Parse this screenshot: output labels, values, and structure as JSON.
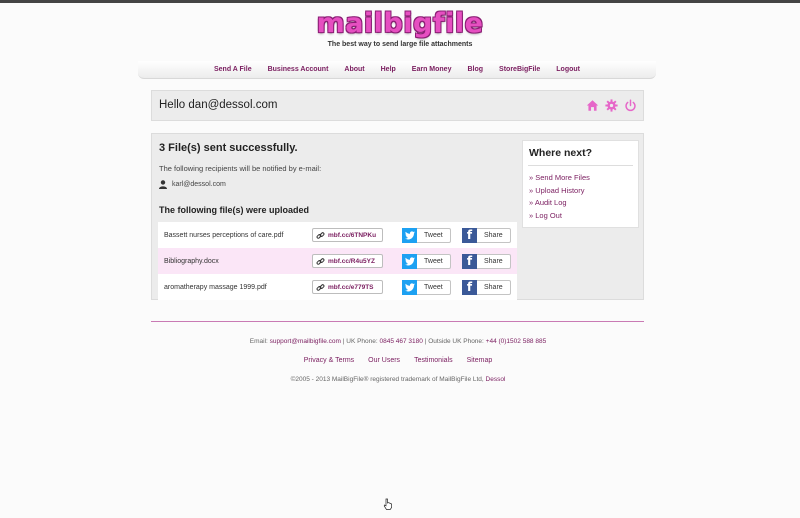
{
  "brand": {
    "logo": "mailbigfile",
    "tagline": "The best way to send large file attachments"
  },
  "nav": [
    "Send A File",
    "Business Account",
    "About",
    "Help",
    "Earn Money",
    "Blog",
    "StoreBigFile",
    "Logout"
  ],
  "header": {
    "greeting": "Hello dan@dessol.com",
    "icons": [
      "home-icon",
      "gear-icon",
      "power-icon"
    ]
  },
  "main": {
    "success": "3 File(s) sent successfully.",
    "notify_text": "The following recipients will be notified by e-mail:",
    "recipient": "karl@dessol.com",
    "uploaded_title": "The following file(s) were uploaded",
    "tweet_label": "Tweet",
    "share_label": "Share",
    "files": [
      {
        "name": "Bassett nurses perceptions of care.pdf",
        "link": "mbf.cc/6TNPKu"
      },
      {
        "name": "Bibliography.docx",
        "link": "mbf.cc/R4u5YZ"
      },
      {
        "name": "aromatherapy massage 1999.pdf",
        "link": "mbf.cc/e779TS"
      }
    ]
  },
  "where_next": {
    "title": "Where next?",
    "items": [
      "» Send More Files",
      "» Upload History",
      "» Audit Log",
      "» Log Out"
    ]
  },
  "footer": {
    "email_label": "Email:",
    "email": "support@mailbigfile.com",
    "uk_label": "| UK Phone:",
    "uk_phone": "0845 467 3180",
    "outside_label": "| Outside UK Phone:",
    "outside_phone": "+44 (0)1502 588 885",
    "links": [
      "Privacy & Terms",
      "Our Users",
      "Testimonials",
      "Sitemap"
    ],
    "copyright": "©2005 - 2013 MailBigFile® registered trademark of MailBigFile Ltd,",
    "copyright_link": "Dessol"
  },
  "colors": {
    "accent": "#7a1d5f",
    "logo_pink": "#e64fc1",
    "icon_pink": "#e667c9",
    "row_highlight": "#fbe6f7"
  }
}
